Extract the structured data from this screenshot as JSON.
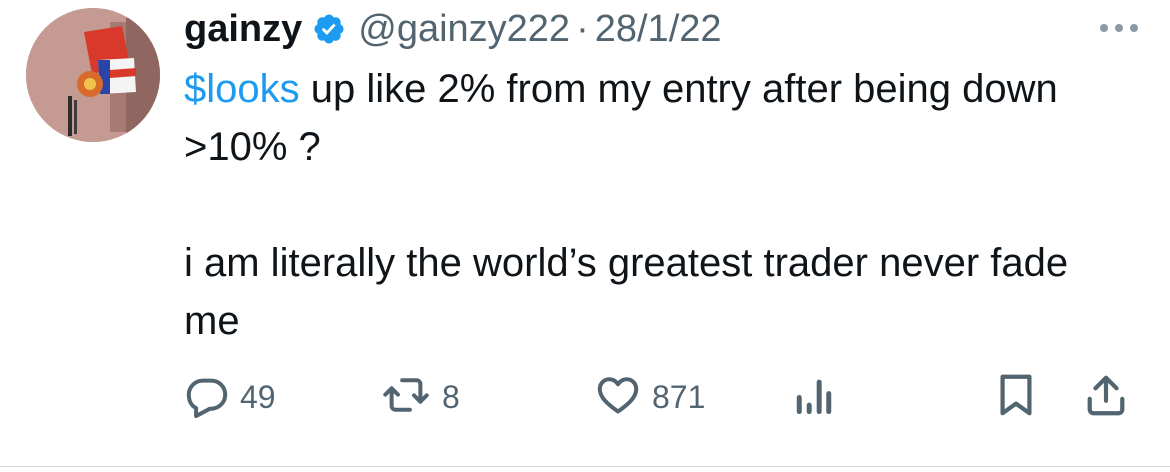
{
  "user": {
    "display_name": "gainzy",
    "handle": "@gainzy222",
    "separator": "·",
    "date": "28/1/22",
    "verified": true
  },
  "tweet": {
    "cashtag": "$looks",
    "text_after_cashtag": " up like 2% from my entry after being down >10% ?\n\ni am literally the world’s greatest trader never fade me"
  },
  "actions": {
    "reply_count": "49",
    "retweet_count": "8",
    "like_count": "871"
  },
  "icons": {
    "reply": "reply-icon",
    "retweet": "retweet-icon",
    "like": "heart-icon",
    "views": "views-chart-icon",
    "bookmark": "bookmark-icon",
    "share": "share-icon",
    "more": "more-icon",
    "verified": "verified-badge-icon"
  },
  "colors": {
    "accent": "#1d9bf0",
    "text": "#0f1419",
    "secondary": "#536471"
  }
}
